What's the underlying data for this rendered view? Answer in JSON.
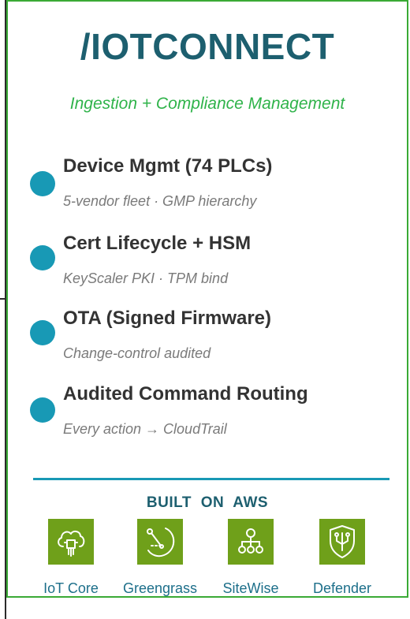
{
  "header": {
    "title": "/IOTCONNECT",
    "subtitle": "Ingestion + Compliance Management"
  },
  "features": [
    {
      "label": "Device Mgmt (74 PLCs)",
      "sub": "5-vendor fleet · GMP hierarchy"
    },
    {
      "label": "Cert Lifecycle + HSM",
      "sub": "KeyScaler PKI · TPM bind"
    },
    {
      "label": "OTA (Signed Firmware)",
      "sub": "Change-control audited"
    },
    {
      "label": "Audited Command Routing",
      "sub": "Every action → CloudTrail"
    }
  ],
  "aws": {
    "heading": "BUILT ON AWS",
    "services": [
      {
        "name": "IoT Core",
        "icon": "cloud-chip-icon"
      },
      {
        "name": "Greengrass",
        "icon": "greengrass-icon"
      },
      {
        "name": "SiteWise",
        "icon": "hierarchy-icon"
      },
      {
        "name": "Defender",
        "icon": "shield-circuit-icon"
      }
    ]
  },
  "colors": {
    "border": "#3aaa35",
    "title": "#1d5f6f",
    "subtitle": "#2fb34a",
    "dot": "#1899b5",
    "tile": "#6fa01a",
    "service_label": "#1d6f8a"
  }
}
